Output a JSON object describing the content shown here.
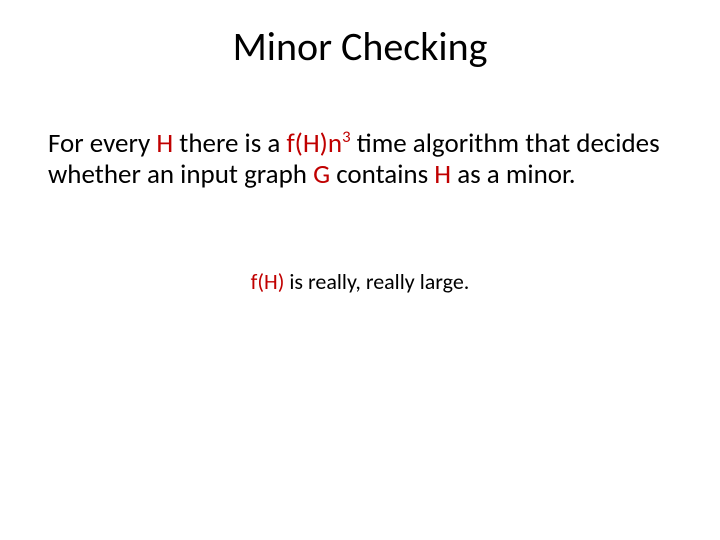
{
  "title": "Minor Checking",
  "body": {
    "t0": "For every ",
    "H1": "H",
    "t1": " there is a ",
    "fH": "f(H)n",
    "exp": "3",
    "t2": " time algorithm that decides whether an input graph ",
    "G": "G",
    "t3": " contains ",
    "H2": "H",
    "t4": " as a minor."
  },
  "note": {
    "n0": "f(H)",
    "n1": " is really, really large."
  }
}
